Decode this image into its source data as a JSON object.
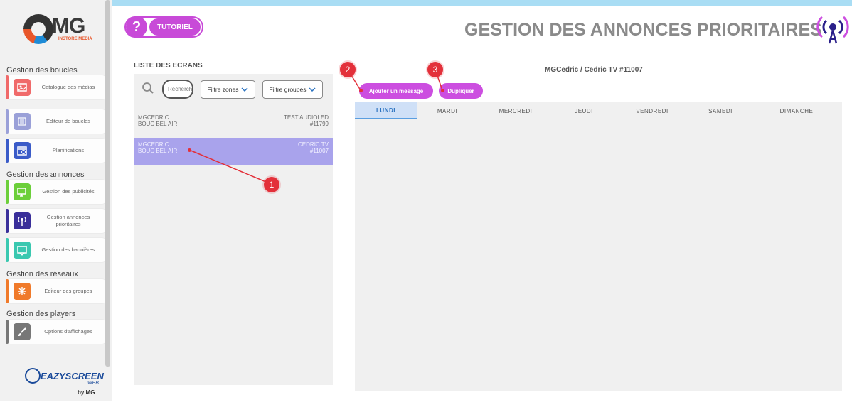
{
  "brand": {
    "logo_text": "MG",
    "logo_sub": "INSTORE MEDIA",
    "footer_brand": "EAZYSCREEN",
    "footer_web": "WEB",
    "footer_by": "by MG"
  },
  "header": {
    "tutoriel_label": "TUTORIEL",
    "page_title": "GESTION DES ANNONCES PRIORITAIRES"
  },
  "sidebar": {
    "sections": [
      {
        "title": "Gestion des boucles"
      },
      {
        "title": "Gestion des annonces"
      },
      {
        "title": "Gestion des réseaux"
      },
      {
        "title": "Gestion des players"
      }
    ],
    "items": [
      {
        "label": "Catalogue des médias",
        "icon": "media-catalog-icon",
        "color": "#f06a6a"
      },
      {
        "label": "Editeur de boucles",
        "icon": "loop-editor-icon",
        "color": "#9aa0d8"
      },
      {
        "label": "Planifications",
        "icon": "calendar-icon",
        "color": "#3a5bc8"
      },
      {
        "label": "Gestion des publicités",
        "icon": "ad-screen-icon",
        "color": "#6ccf3a"
      },
      {
        "label": "Gestion annonces prioritaires",
        "icon": "broadcast-icon",
        "color": "#3a2f9a"
      },
      {
        "label": "Gestion des bannières",
        "icon": "banner-icon",
        "color": "#3ac8b0"
      },
      {
        "label": "Editeur des groupes",
        "icon": "group-network-icon",
        "color": "#f07a2a"
      },
      {
        "label": "Options d'affichages",
        "icon": "brush-icon",
        "color": "#777777"
      }
    ]
  },
  "screens_panel": {
    "title": "LISTE DES ECRANS",
    "search_placeholder": "Recherche",
    "filter_zones": "Filtre zones",
    "filter_groups": "Filtre groupes",
    "rows": [
      {
        "line1": "MGCEDRIC",
        "line2": "BOUC BEL AIR",
        "name": "TEST AUDIOLED",
        "id": "#11799",
        "selected": false
      },
      {
        "line1": "MGCEDRIC",
        "line2": "BOUC BEL AIR",
        "name": "CEDRIC TV",
        "id": "#11007",
        "selected": true
      }
    ]
  },
  "schedule": {
    "screen_title": "MGCedric / Cedric TV #11007",
    "add_message": "Ajouter un message",
    "duplicate": "Dupliquer",
    "days": [
      "LUNDI",
      "MARDI",
      "MERCREDI",
      "JEUDI",
      "VENDREDI",
      "SAMEDI",
      "DIMANCHE"
    ],
    "active_day": "LUNDI"
  },
  "annotations": {
    "markers": [
      "1",
      "2",
      "3"
    ],
    "color": "#e3303a"
  },
  "colors": {
    "accent": "#cc4ee0",
    "selected_row": "#a9a3ec",
    "title": "#8a8a8a"
  }
}
